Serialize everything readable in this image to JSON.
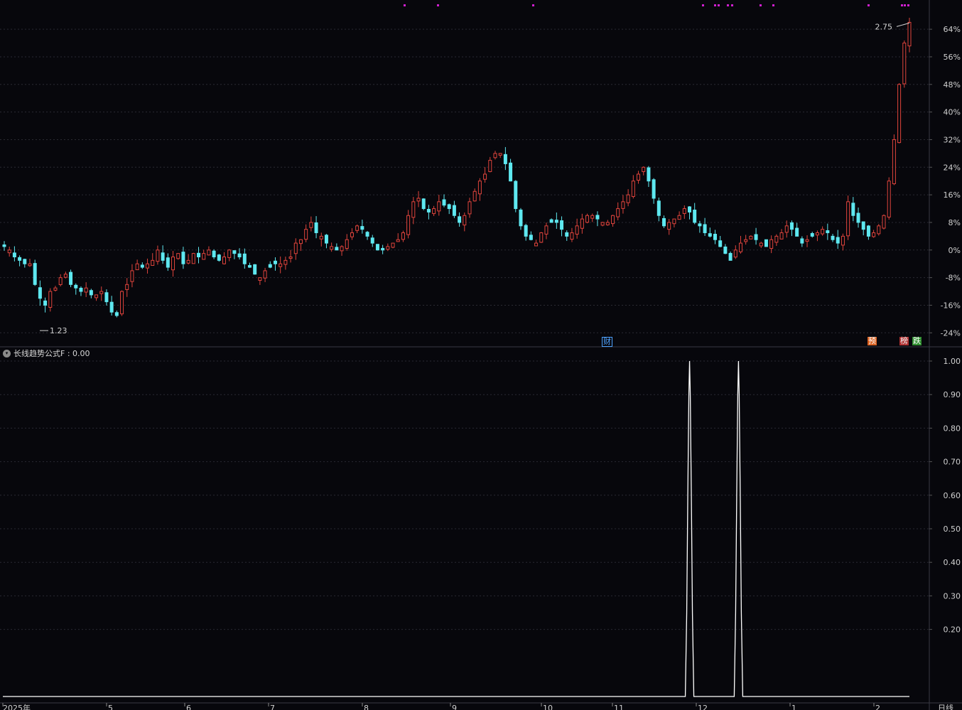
{
  "header": {
    "title": ""
  },
  "indicator": {
    "title": "长线趋势公式F : 0.00",
    "toggle_icon": "chevron-down-icon"
  },
  "badges": {
    "cai": "财",
    "yu": "预",
    "bang": "榜",
    "die": "跌"
  },
  "price_axis": {
    "labels": [
      "64%",
      "56%",
      "48%",
      "40%",
      "32%",
      "24%",
      "16%",
      "8%",
      "0%",
      "-8%",
      "-16%",
      "-24%"
    ],
    "high_label": "2.75",
    "low_label": "1.23"
  },
  "indicator_axis": {
    "labels": [
      "1.00",
      "0.90",
      "0.80",
      "0.70",
      "0.60",
      "0.50",
      "0.40",
      "0.30",
      "0.20"
    ]
  },
  "time_axis": {
    "labels": [
      "2025年",
      "5",
      "6",
      "7",
      "8",
      "9",
      "10",
      "11",
      "12",
      "1",
      "2"
    ],
    "period": "日线"
  },
  "colors": {
    "up": "#e0443c",
    "down": "#5ee8f0",
    "background": "#07070c",
    "grid": "#2a2a33",
    "marker": "#d01fd0",
    "line": "#ffffff"
  },
  "chart_data": [
    {
      "type": "candlestick",
      "title": "",
      "y_unit": "percent change",
      "ylim": [
        -26,
        70
      ],
      "y_ticks": [
        64,
        56,
        48,
        40,
        32,
        24,
        16,
        8,
        0,
        -8,
        -16,
        -24
      ],
      "x_month_labels": [
        "2025年",
        "5",
        "6",
        "7",
        "8",
        "9",
        "10",
        "11",
        "12",
        "1",
        "2"
      ],
      "high": {
        "pct": 66,
        "label": "2.75"
      },
      "low": {
        "pct": -25,
        "label": "1.23"
      },
      "close_path_pct": [
        1,
        0,
        -2,
        -3,
        -4,
        -4,
        -10,
        -14,
        -16,
        -12,
        -11,
        -8,
        -7,
        -10,
        -11,
        -12,
        -11,
        -13,
        -13,
        -12,
        -15,
        -18,
        -19,
        -12,
        -10,
        -6,
        -4,
        -5,
        -4,
        -3,
        0,
        -3,
        -5,
        -2,
        -1,
        -4,
        -3,
        -1,
        -2,
        -1,
        0,
        -2,
        -3,
        -2,
        0,
        -1,
        -2,
        -4,
        -5,
        -7,
        -8,
        -6,
        -5,
        -4,
        -4,
        -3,
        -2,
        2,
        3,
        6,
        8,
        5,
        4,
        2,
        1,
        0,
        1,
        3,
        5,
        7,
        6,
        4,
        2,
        0,
        0,
        1,
        2,
        3,
        5,
        10,
        14,
        15,
        12,
        11,
        12,
        14,
        13,
        12,
        10,
        8,
        10,
        14,
        17,
        20,
        22,
        26,
        28,
        28,
        25,
        20,
        12,
        7,
        4,
        3,
        2,
        5,
        7,
        8,
        8,
        6,
        4,
        5,
        7,
        9,
        10,
        10,
        9,
        8,
        8,
        10,
        12,
        14,
        16,
        20,
        22,
        24,
        20,
        15,
        10,
        7,
        8,
        9,
        10,
        12,
        11,
        8,
        7,
        5,
        4,
        3,
        1,
        -1,
        -3,
        0,
        2,
        3,
        4,
        3,
        2,
        1,
        3,
        4,
        5,
        7,
        6,
        4,
        2,
        3,
        4,
        5,
        6,
        5,
        3,
        2,
        4,
        14,
        10,
        8,
        6,
        4,
        5,
        7,
        10,
        20,
        32,
        48,
        60,
        66
      ]
    },
    {
      "type": "line",
      "title": "长线趋势公式F",
      "ylim": [
        0,
        1
      ],
      "y_ticks": [
        1.0,
        0.9,
        0.8,
        0.7,
        0.6,
        0.5,
        0.4,
        0.3,
        0.2
      ],
      "spikes": [
        {
          "month_pos": 7.92,
          "value": 1.0
        },
        {
          "month_pos": 8.45,
          "value": 1.0
        }
      ],
      "baseline": 0
    }
  ]
}
